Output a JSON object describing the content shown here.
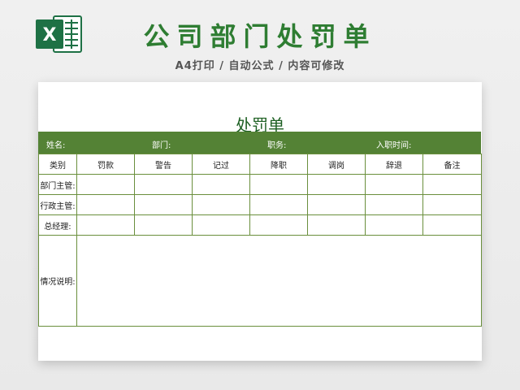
{
  "banner": {
    "title": "公司部门处罚单",
    "subtitle": "A4打印 / 自动公式 / 内容可修改",
    "logo_letter": "X",
    "logo_color": "#1e7145"
  },
  "form": {
    "title": "处罚单",
    "info": {
      "name_label": "姓名:",
      "dept_label": "部门:",
      "position_label": "职务:",
      "join_label": "入职时间:"
    },
    "headers": {
      "category": "类别",
      "fine": "罚款",
      "warning": "警告",
      "record": "记过",
      "demotion": "降职",
      "transfer": "调岗",
      "dismissal": "辞退",
      "notes": "备注"
    },
    "rows": {
      "dept_manager": "部门主管:",
      "admin_manager": "行政主管:",
      "general_manager": "总经理:",
      "description": "情况说明:"
    }
  },
  "colors": {
    "accent": "#548235",
    "title_green": "#2e7d32"
  }
}
